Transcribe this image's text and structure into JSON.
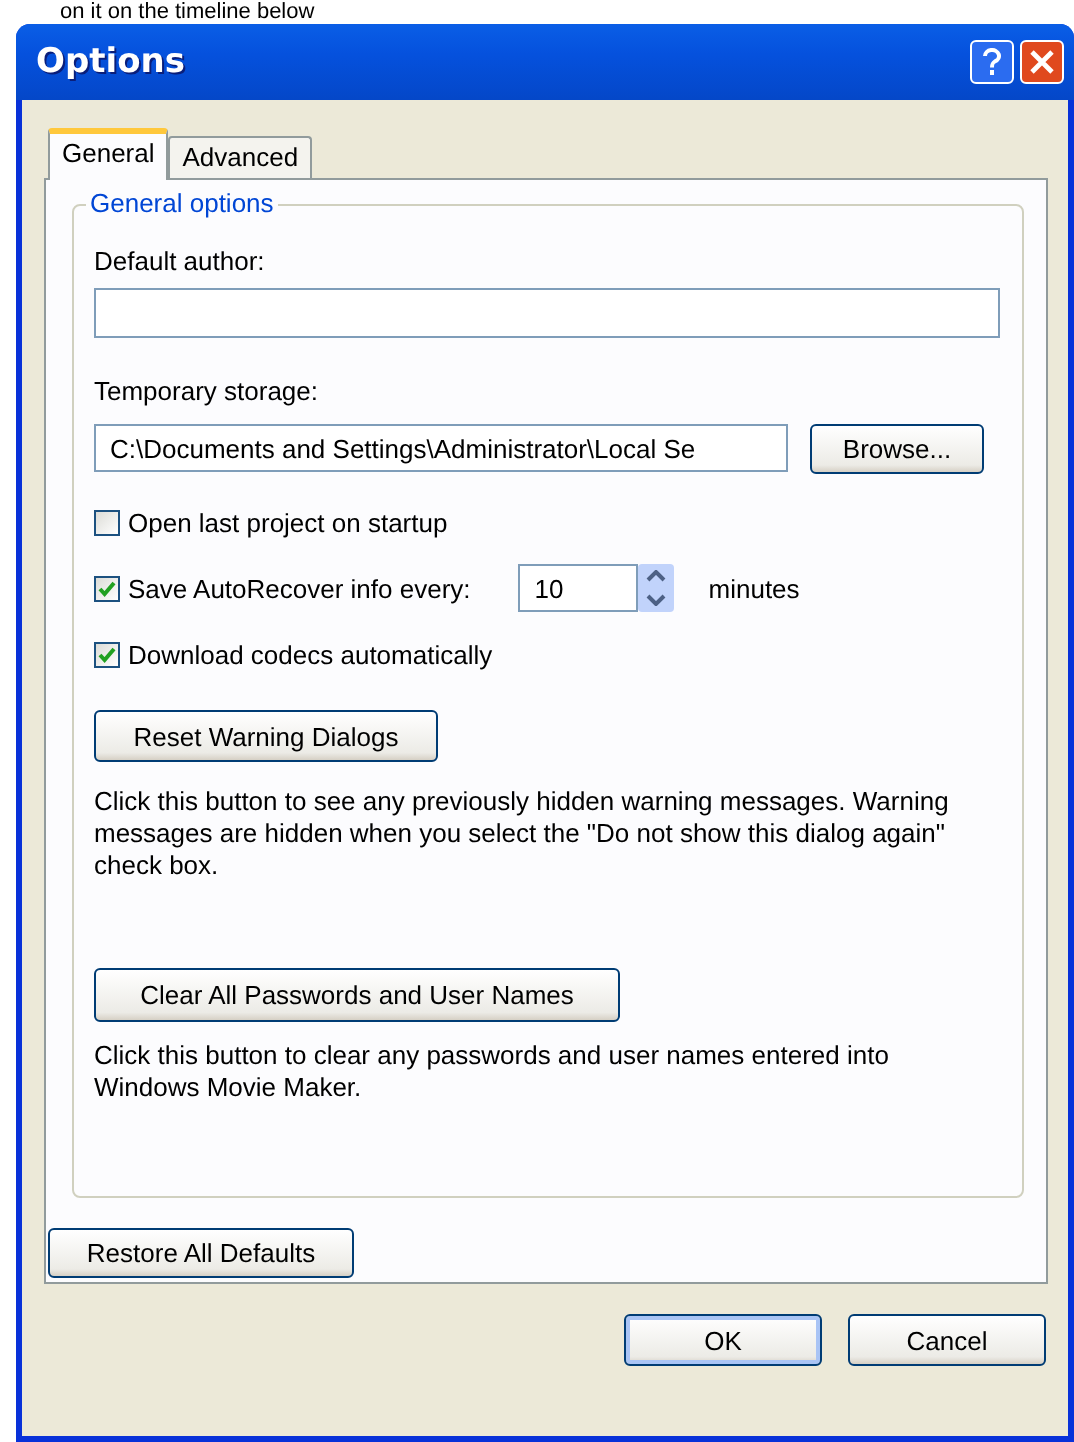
{
  "background_text": "on it on the timeline below",
  "window": {
    "title": "Options"
  },
  "tabs": [
    {
      "label": "General",
      "selected": true
    },
    {
      "label": "Advanced",
      "selected": false
    }
  ],
  "group": {
    "title": "General options",
    "default_author": {
      "label": "Default author:"
    },
    "temporary_storage": {
      "label": "Temporary storage:",
      "value": "C:\\Documents and Settings\\Administrator\\Local Se",
      "button": "Browse..."
    },
    "checkboxes": [
      {
        "label": "Open last project on startup",
        "checked": false
      },
      {
        "label": "Save AutoRecover info every:",
        "checked": true,
        "spin_value": "10",
        "unit": "minutes"
      },
      {
        "label": "Download codecs automatically",
        "checked": true
      }
    ],
    "reset_button": "Reset Warning Dialogs",
    "reset_note": "Click this button to see any previously hidden warning messages. Warning messages are hidden when you select the \"Do not show this dialog again\" check box.",
    "clear_button": "Clear All Passwords and User Names",
    "clear_note": "Click this button to clear any passwords and user names entered into Windows Movie Maker."
  },
  "restore_button": "Restore All Defaults",
  "buttons": [
    {
      "label": "OK",
      "default": true
    },
    {
      "label": "Cancel",
      "default": false
    }
  ]
}
